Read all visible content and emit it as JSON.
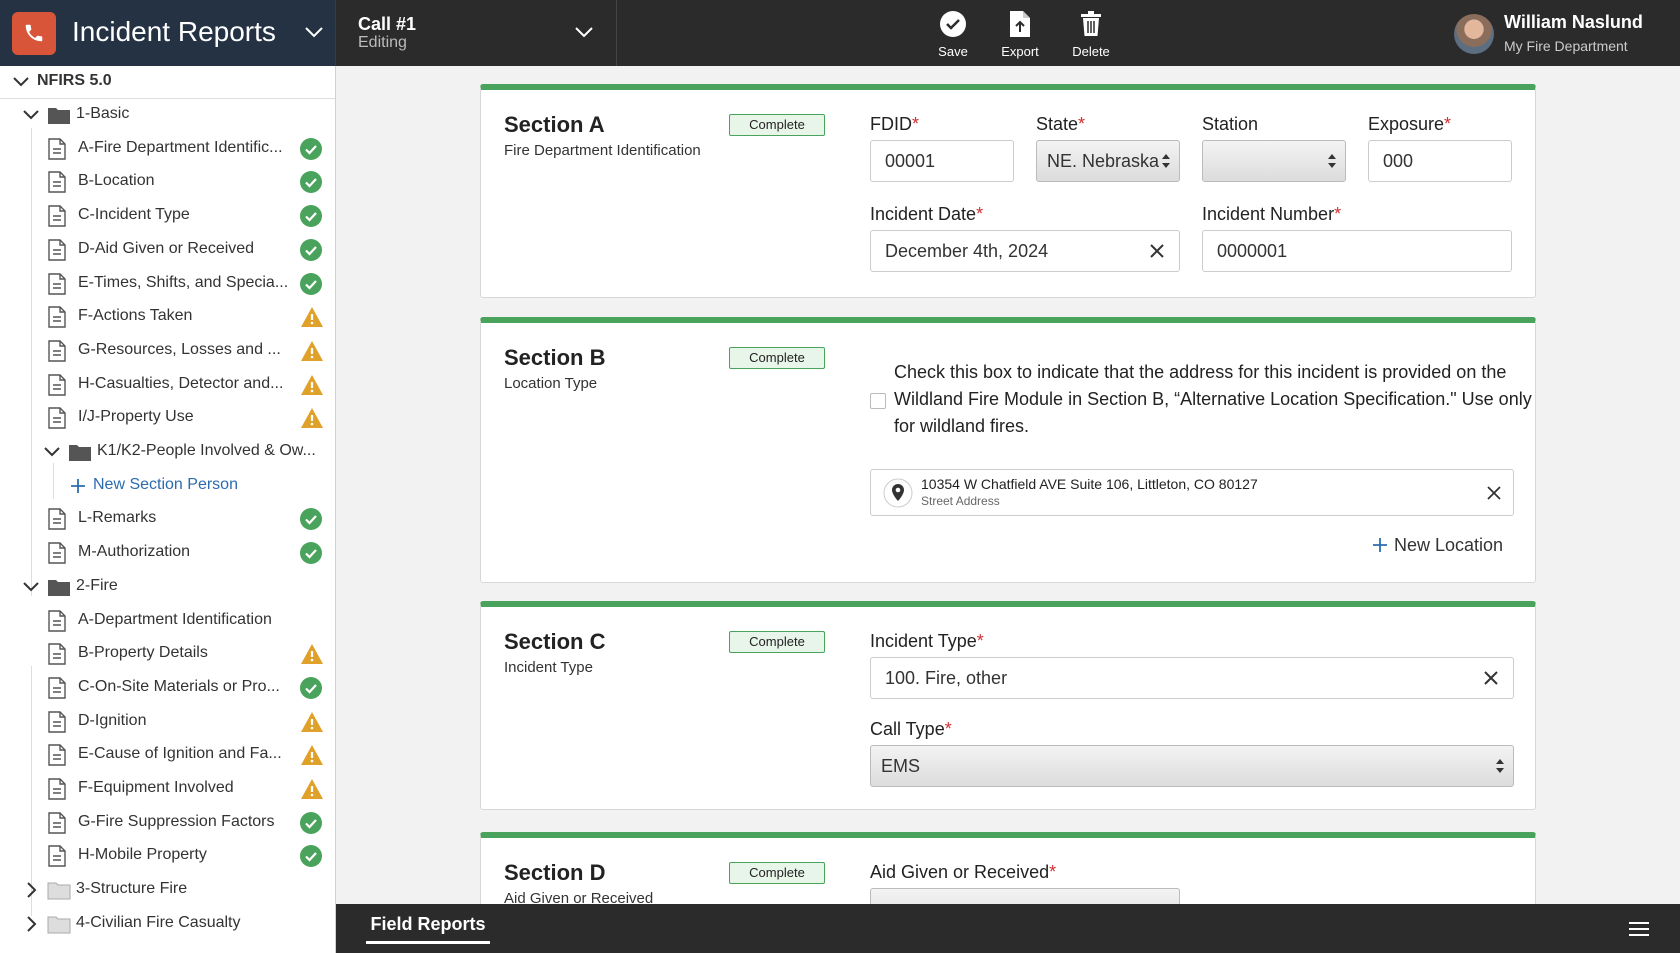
{
  "app": {
    "title": "Incident Reports",
    "brand_color": "#d9553a"
  },
  "call": {
    "title": "Call #1",
    "status": "Editing"
  },
  "toolbar": {
    "save_label": "Save",
    "export_label": "Export",
    "delete_label": "Delete"
  },
  "user": {
    "name": "William Naslund",
    "department": "My Fire Department"
  },
  "sidebar": {
    "root": "NFIRS 5.0",
    "basic": {
      "label": "1-Basic",
      "items": [
        {
          "label": "A-Fire Department Identific...",
          "status": "complete"
        },
        {
          "label": "B-Location",
          "status": "complete"
        },
        {
          "label": "C-Incident Type",
          "status": "complete"
        },
        {
          "label": "D-Aid Given or Received",
          "status": "complete"
        },
        {
          "label": "E-Times, Shifts, and Specia...",
          "status": "complete"
        },
        {
          "label": "F-Actions Taken",
          "status": "warning"
        },
        {
          "label": "G-Resources, Losses and ...",
          "status": "warning"
        },
        {
          "label": "H-Casualties, Detector and...",
          "status": "warning"
        },
        {
          "label": "I/J-Property Use",
          "status": "warning"
        }
      ],
      "people_folder": "K1/K2-People Involved & Ow...",
      "new_person": "New Section Person",
      "after_items": [
        {
          "label": "L-Remarks",
          "status": "complete"
        },
        {
          "label": "M-Authorization",
          "status": "complete"
        }
      ]
    },
    "fire": {
      "label": "2-Fire",
      "items": [
        {
          "label": "A-Department Identification",
          "status": "none"
        },
        {
          "label": "B-Property Details",
          "status": "warning"
        },
        {
          "label": "C-On-Site Materials or Pro...",
          "status": "complete"
        },
        {
          "label": "D-Ignition",
          "status": "warning"
        },
        {
          "label": "E-Cause of Ignition and Fa...",
          "status": "warning"
        },
        {
          "label": "F-Equipment Involved",
          "status": "warning"
        },
        {
          "label": "G-Fire Suppression Factors",
          "status": "complete"
        },
        {
          "label": "H-Mobile Property",
          "status": "complete"
        }
      ]
    },
    "collapsed": [
      "3-Structure Fire",
      "4-Civilian Fire Casualty"
    ]
  },
  "sections": {
    "a": {
      "title": "Section A",
      "subtitle": "Fire Department Identification",
      "badge": "Complete",
      "fdid_label": "FDID",
      "fdid_value": "00001",
      "state_label": "State",
      "state_value": "NE. Nebraska",
      "station_label": "Station",
      "station_value": "",
      "exposure_label": "Exposure",
      "exposure_value": "000",
      "date_label": "Incident Date",
      "date_value": "December 4th, 2024",
      "number_label": "Incident Number",
      "number_value": "0000001"
    },
    "b": {
      "title": "Section B",
      "subtitle": "Location Type",
      "badge": "Complete",
      "checkbox_text": "Check this box to indicate that the address for this incident is provided on the Wildland Fire Module in Section B, “Alternative Location Specification.\" Use only for wildland fires.",
      "address": "10354 W Chatfield AVE Suite 106, Littleton, CO 80127",
      "address_type": "Street Address",
      "new_location": "New Location"
    },
    "c": {
      "title": "Section C",
      "subtitle": "Incident Type",
      "badge": "Complete",
      "type_label": "Incident Type",
      "type_value": "100. Fire, other",
      "call_label": "Call Type",
      "call_value": "EMS"
    },
    "d": {
      "title": "Section D",
      "subtitle": "Aid Given or Received",
      "badge": "Complete",
      "aid_label": "Aid Given or Received"
    }
  },
  "bottom": {
    "tab": "Field Reports"
  },
  "colors": {
    "complete": "#4aa35c",
    "warning": "#e0a12b",
    "required": "#d32f2f",
    "link": "#2b6cb0"
  }
}
